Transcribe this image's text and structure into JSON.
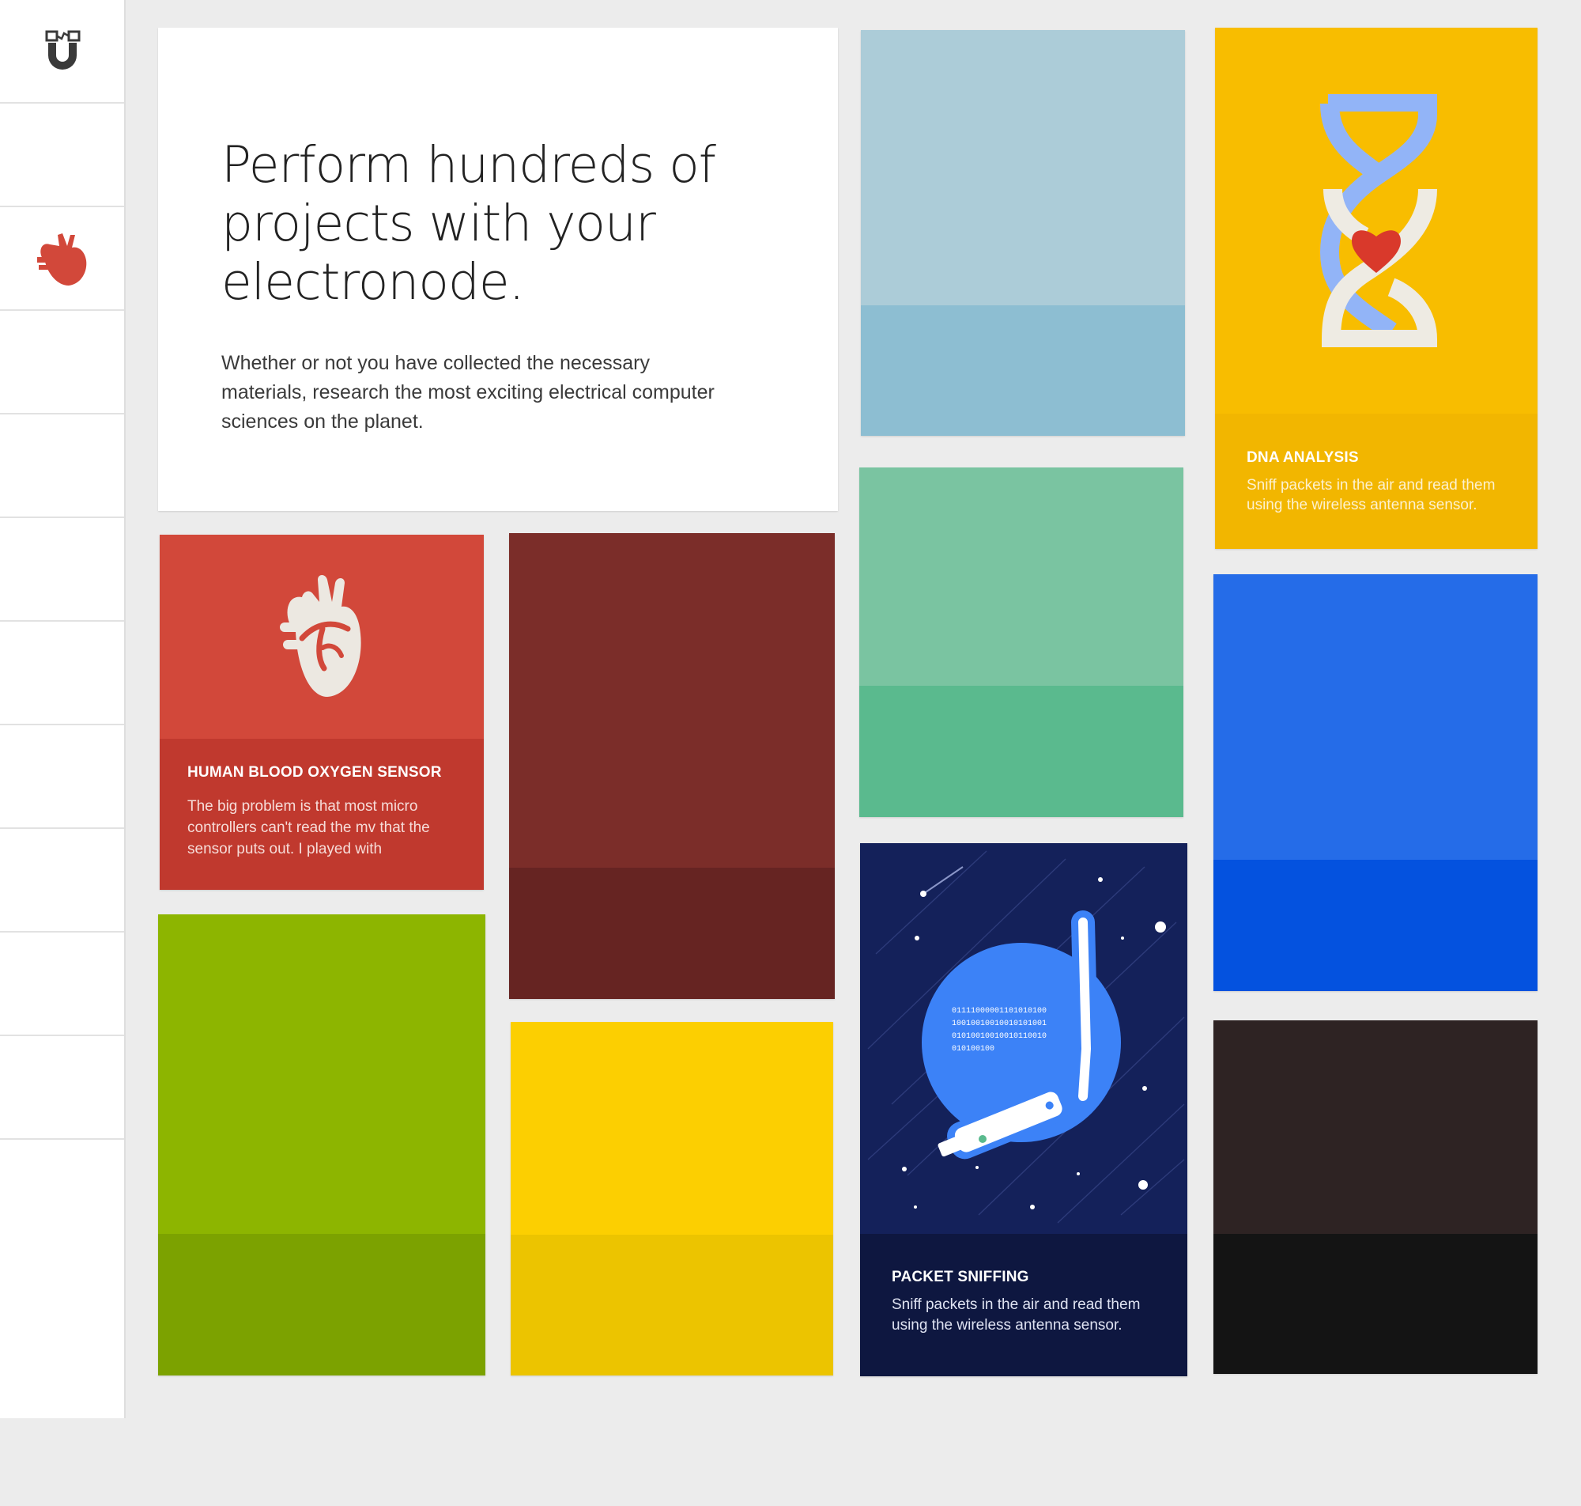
{
  "hero": {
    "heading": "Perform hundreds of projects with your electronode.",
    "body": "Whether or not you have collected the necessary materials, research the most exciting electrical computer sciences on the planet."
  },
  "sidebar": {
    "logo_icon": "magnet-logo-icon",
    "items": [
      {
        "icon": "none"
      },
      {
        "icon": "heart-icon",
        "color": "#d2483a"
      },
      {
        "icon": "none"
      },
      {
        "icon": "none"
      },
      {
        "icon": "none"
      },
      {
        "icon": "none"
      },
      {
        "icon": "none"
      },
      {
        "icon": "none"
      },
      {
        "icon": "none"
      },
      {
        "icon": "none"
      }
    ]
  },
  "cards": {
    "blood_oxygen": {
      "title": "HUMAN BLOOD OXYGEN SENSOR",
      "description": "The big problem is that most micro controllers can't read the mv that the sensor puts out. I played with",
      "icon": "heart-icon",
      "top_color": "#d2483a",
      "band_color": "#c0392e"
    },
    "dna": {
      "title": "DNA ANALYSIS",
      "description": "Sniff packets in the air and read them using the wireless antenna sensor.",
      "icon": "dna-icon",
      "top_color": "#f8bd00",
      "band_color": "#f2b600"
    },
    "packet": {
      "title": "PACKET SNIFFING",
      "description": "Sniff packets in the air and read them using the wireless antenna sensor.",
      "icon": "wireless-antenna-icon",
      "binary": [
        "01111000001101010100",
        "10010010010010101001",
        "01010010010010110010",
        "010100100"
      ],
      "top_color": "#14215a",
      "band_color": "#0e1740"
    },
    "placeholders": [
      {
        "name": "light-blue",
        "top": "#acccd8",
        "band": "#8dbed2"
      },
      {
        "name": "dark-red",
        "top": "#7b2d29",
        "band": "#662422"
      },
      {
        "name": "green",
        "top": "#7ac4a1",
        "band": "#5aba8e"
      },
      {
        "name": "blue",
        "top": "#256ce8",
        "band": "#0452df"
      },
      {
        "name": "olive",
        "top": "#8db500",
        "band": "#7ca200"
      },
      {
        "name": "yellow",
        "top": "#fccf01",
        "band": "#ecc400"
      },
      {
        "name": "dark-brown",
        "top": "#2e2323",
        "band": "#141414"
      }
    ]
  }
}
